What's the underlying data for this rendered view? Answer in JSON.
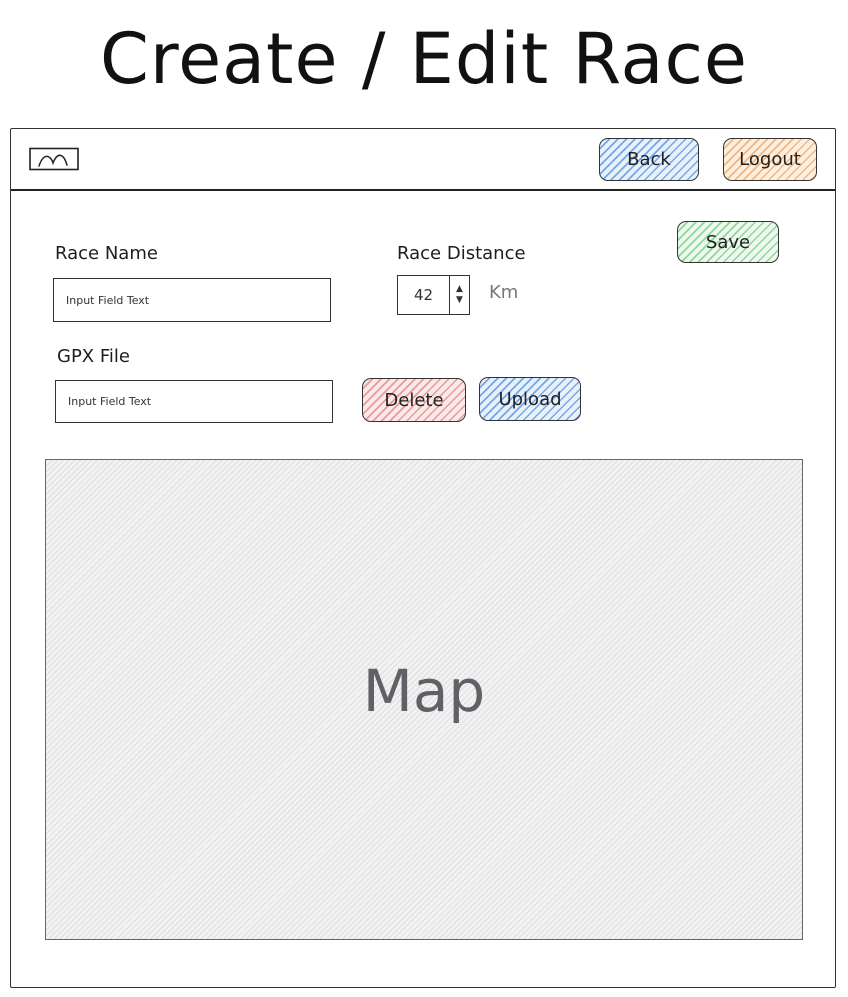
{
  "page": {
    "title": "Create / Edit Race"
  },
  "navbar": {
    "logo_icon": "image-placeholder-icon",
    "back_label": "Back",
    "logout_label": "Logout"
  },
  "form": {
    "save_label": "Save",
    "race_name": {
      "label": "Race Name",
      "placeholder": "Input Field Text"
    },
    "race_distance": {
      "label": "Race Distance",
      "value": "42",
      "unit": "Km",
      "stepper_icon": "up-down-arrows-icon"
    },
    "gpx_file": {
      "label": "GPX File",
      "placeholder": "Input Field Text",
      "delete_label": "Delete",
      "upload_label": "Upload"
    }
  },
  "map": {
    "label": "Map"
  },
  "colors": {
    "back_button": "#74a7e3",
    "logout_button": "#f2b680",
    "save_button": "#8ed69a",
    "delete_button": "#e69a9a",
    "upload_button": "#74a7e3"
  }
}
